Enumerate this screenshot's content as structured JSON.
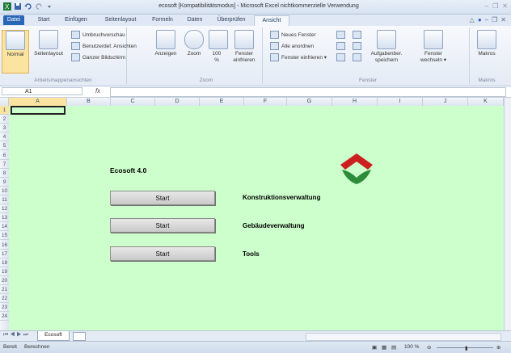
{
  "window": {
    "title": "ecosoft  [Kompatibilitätsmodus]  -  Microsoft Excel nichtkommerzielle Verwendung"
  },
  "tabs": [
    "Datei",
    "Start",
    "Einfügen",
    "Seitenlayout",
    "Formeln",
    "Daten",
    "Überprüfen",
    "Ansicht"
  ],
  "ribbon": {
    "group1": {
      "normal": "Normal",
      "seitenlayout": "Seitenlayout",
      "umbruch": "Umbruchvorschau",
      "benutzer": "Benutzerdef. Ansichten",
      "ganzer": "Ganzer Bildschirm",
      "label": "Arbeitsmappenansichten"
    },
    "group2": {
      "anzeigen": "Anzeigen",
      "zoom": "Zoom",
      "zoom100a": "100",
      "zoom100b": "%",
      "fenster_a": "Fenster",
      "fenster_b": "einfrieren",
      "label": "Zoom"
    },
    "group3": {
      "neues": "Neues Fenster",
      "alle": "Alle anordnen",
      "einfrieren": "Fenster einfrieren ▾",
      "arbeit_a": "Aufgabenber.",
      "arbeit_b": "speichern",
      "wechsel_a": "Fenster",
      "wechsel_b": "wechseln ▾",
      "label": "Fenster"
    },
    "group4": {
      "makros": "Makros",
      "label": "Makros"
    }
  },
  "formula": {
    "namebox": "A1",
    "fx": "fx"
  },
  "columns": [
    "A",
    "B",
    "C",
    "D",
    "E",
    "F",
    "G",
    "H",
    "I",
    "J",
    "K"
  ],
  "rows": [
    "1",
    "2",
    "3",
    "4",
    "5",
    "6",
    "7",
    "8",
    "9",
    "10",
    "11",
    "12",
    "13",
    "14",
    "15",
    "16",
    "17",
    "18",
    "19",
    "20",
    "21",
    "22",
    "23",
    "24"
  ],
  "sheet": {
    "title": "Ecosoft 4.0",
    "buttons": [
      {
        "label": "Start",
        "module": "Konstruktionsverwaltung"
      },
      {
        "label": "Start",
        "module": "Gebäudeverwaltung"
      },
      {
        "label": "Start",
        "module": "Tools"
      }
    ],
    "logo_colors": {
      "top": "#cc1f1f",
      "bottom": "#2e8b3a"
    },
    "background": "#ccffcc"
  },
  "sheet_tabs": {
    "active": "Ecosoft"
  },
  "status": {
    "left1": "Bereit",
    "left2": "Berechnen",
    "zoom": "100 %"
  }
}
